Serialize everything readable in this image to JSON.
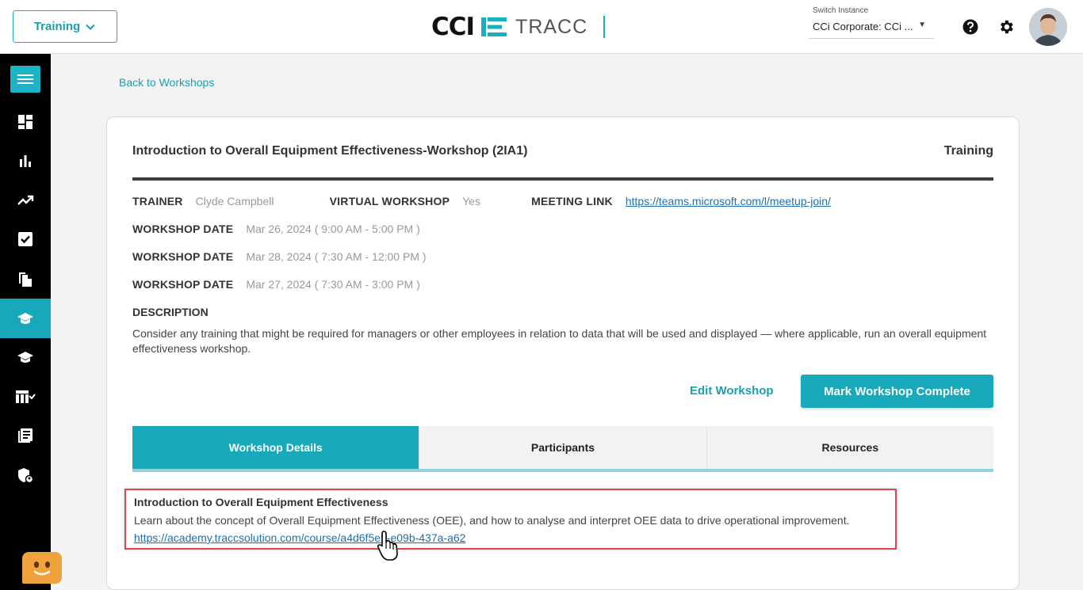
{
  "header": {
    "module_label": "Training",
    "logo_cci": "CCI",
    "logo_tracc": "TRACC",
    "switch_label": "Switch Instance",
    "switch_value": "CCi Corporate: CCi ..."
  },
  "nav": {
    "back_link": "Back to Workshops"
  },
  "workshop": {
    "title": "Introduction to Overall Equipment Effectiveness-Workshop (2IA1)",
    "category": "Training",
    "trainer_label": "TRAINER",
    "trainer_value": "Clyde Campbell",
    "virtual_label": "VIRTUAL WORKSHOP",
    "virtual_value": "Yes",
    "meeting_label": "MEETING LINK",
    "meeting_value": "https://teams.microsoft.com/l/meetup-join/",
    "dates": [
      {
        "label": "WORKSHOP DATE",
        "value": "Mar 26, 2024 ( 9:00 AM - 5:00 PM )"
      },
      {
        "label": "WORKSHOP DATE",
        "value": "Mar 28, 2024 ( 7:30 AM - 12:00 PM )"
      },
      {
        "label": "WORKSHOP DATE",
        "value": "Mar 27, 2024 ( 7:30 AM - 3:00 PM )"
      }
    ],
    "description_label": "DESCRIPTION",
    "description": "Consider any training that might be required for managers or other employees in relation to data that will be used and displayed — where applicable, run an overall equipment effectiveness workshop.",
    "edit_label": "Edit Workshop",
    "complete_label": "Mark Workshop Complete"
  },
  "tabs": [
    {
      "label": "Workshop Details",
      "active": true
    },
    {
      "label": "Participants",
      "active": false
    },
    {
      "label": "Resources",
      "active": false
    }
  ],
  "details": {
    "title": "Introduction to Overall Equipment Effectiveness",
    "text": "Learn about the concept of Overall Equipment Effectiveness (OEE), and how to analyse and interpret OEE data to drive operational improvement.",
    "link": "https://academy.traccsolution.com/course/a4d6f5e5-e09b-437a-a62"
  },
  "colors": {
    "accent": "#18aabb",
    "sidebar": "#000000",
    "highlight_border": "#e0474c"
  },
  "icons": {
    "sidebar": [
      "menu-icon",
      "dashboard-icon",
      "bar-chart-icon",
      "trend-icon",
      "checkbox-icon",
      "documents-icon",
      "graduation-cap-icon",
      "graduation-cap-outline-icon",
      "table-check-icon",
      "journal-icon",
      "shield-user-icon"
    ],
    "header": [
      "chevron-down-icon",
      "help-icon",
      "gear-icon",
      "avatar"
    ]
  }
}
